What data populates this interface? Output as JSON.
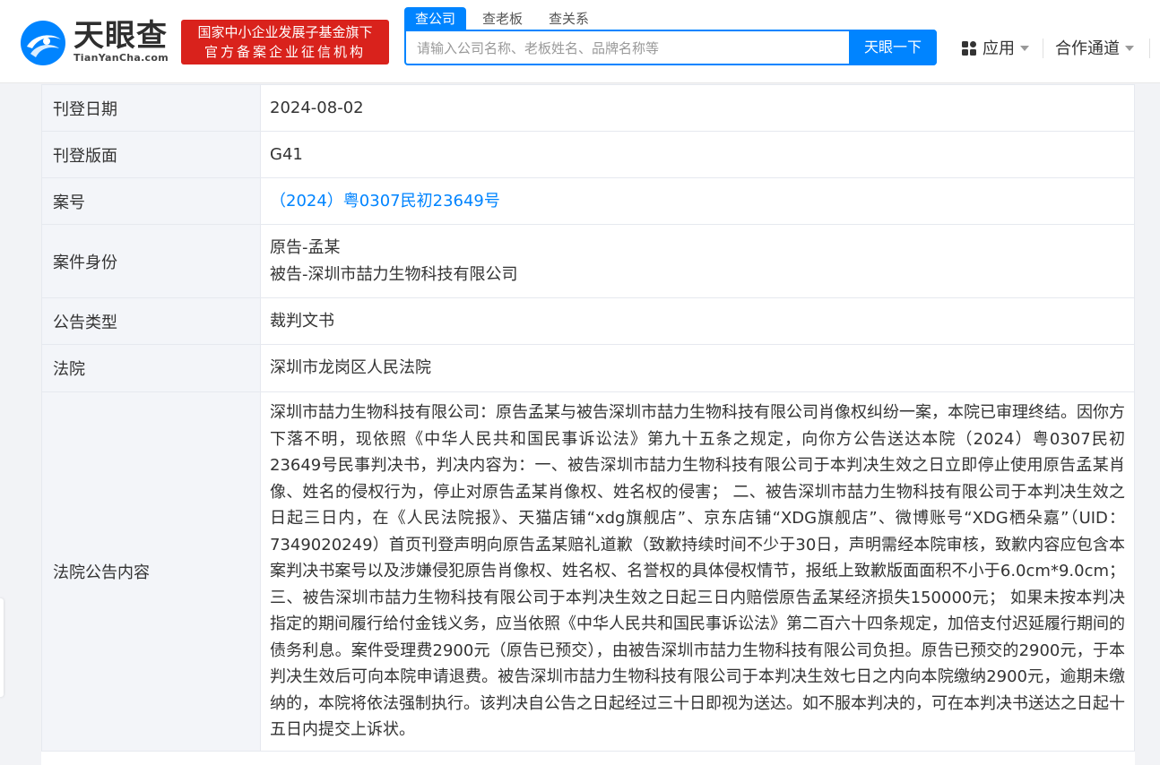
{
  "header": {
    "logo_name": "天眼查",
    "logo_sub": "TianYanCha.com",
    "badge_line1": "国家中小企业发展子基金旗下",
    "badge_line2": "官方备案企业征信机构",
    "tabs": [
      {
        "label": "查公司",
        "active": true
      },
      {
        "label": "查老板",
        "active": false
      },
      {
        "label": "查关系",
        "active": false
      }
    ],
    "search_placeholder": "请输入公司名称、老板姓名、品牌名称等",
    "search_button": "天眼一下",
    "nav_app": "应用",
    "nav_coop": "合作通道",
    "brand_color": "#0084ff",
    "badge_color": "#d9221c"
  },
  "details": [
    {
      "label": "刊登日期",
      "value": "2024-08-02"
    },
    {
      "label": "刊登版面",
      "value": "G41"
    },
    {
      "label": "案号",
      "value": "（2024）粤0307民初23649号",
      "link": true
    },
    {
      "label": "案件身份",
      "values": [
        "原告-孟某",
        "被告-深圳市喆力生物科技有限公司"
      ]
    },
    {
      "label": "公告类型",
      "value": "裁判文书"
    },
    {
      "label": "法院",
      "value": "深圳市龙岗区人民法院"
    },
    {
      "label": "法院公告内容",
      "value": "深圳市喆力生物科技有限公司：原告孟某与被告深圳市喆力生物科技有限公司肖像权纠纷一案，本院已审理终结。因你方下落不明，现依照《中华人民共和国民事诉讼法》第九十五条之规定，向你方公告送达本院（2024）粤0307民初23649号民事判决书，判决内容为：一、被告深圳市喆力生物科技有限公司于本判决生效之日立即停止使用原告孟某肖像、姓名的侵权行为，停止对原告孟某肖像权、姓名权的侵害； 二、被告深圳市喆力生物科技有限公司于本判决生效之日起三日内，在《人民法院报》、天猫店铺“xdg旗舰店”、京东店铺“XDG旗舰店”、微博账号“XDG栖朵嘉”（UID：7349020249）首页刊登声明向原告孟某赔礼道歉（致歉持续时间不少于30日，声明需经本院审核，致歉内容应包含本案判决书案号以及涉嫌侵犯原告肖像权、姓名权、名誉权的具体侵权情节，报纸上致歉版面面积不小于6.0cm*9.0cm； 三、被告深圳市喆力生物科技有限公司于本判决生效之日起三日内赔偿原告孟某经济损失150000元； 如果未按本判决指定的期间履行给付金钱义务，应当依照《中华人民共和国民事诉讼法》第二百六十四条规定，加倍支付迟延履行期间的债务利息。案件受理费2900元（原告已预交），由被告深圳市喆力生物科技有限公司负担。原告已预交的2900元，于本判决生效后可向本院申请退费。被告深圳市喆力生物科技有限公司于本判决生效七日之内向本院缴纳2900元，逾期未缴纳的，本院将依法强制执行。该判决自公告之日起经过三十日即视为送达。如不服本判决的，可在本判决书送达之日起十五日内提交上诉状。"
    }
  ]
}
